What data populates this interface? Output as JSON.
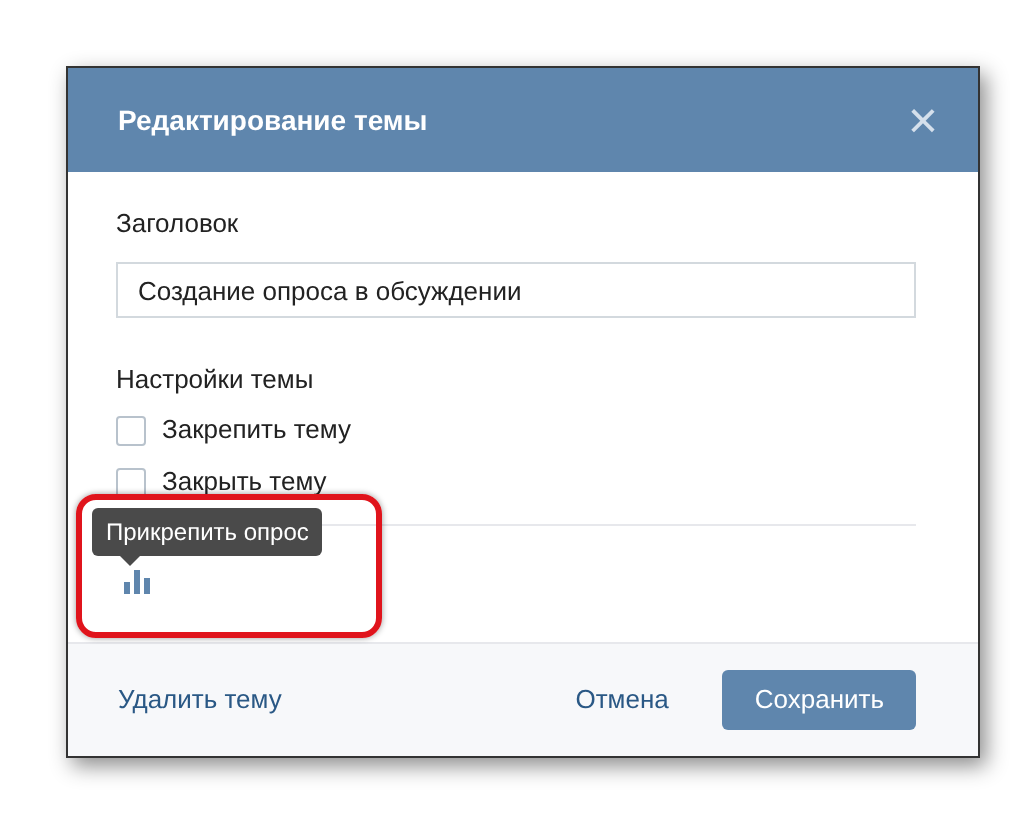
{
  "dialog": {
    "title": "Редактирование темы",
    "close": "×"
  },
  "title_field": {
    "label": "Заголовок",
    "value": "Создание опроса в обсуждении"
  },
  "settings": {
    "heading": "Настройки темы",
    "options": [
      {
        "label": "Закрепить тему",
        "checked": false
      },
      {
        "label": "Закрыть тему",
        "checked": false
      }
    ]
  },
  "attach": {
    "tooltip": "Прикрепить опрос",
    "highlighted": true
  },
  "footer": {
    "delete": "Удалить тему",
    "cancel": "Отмена",
    "save": "Сохранить"
  }
}
